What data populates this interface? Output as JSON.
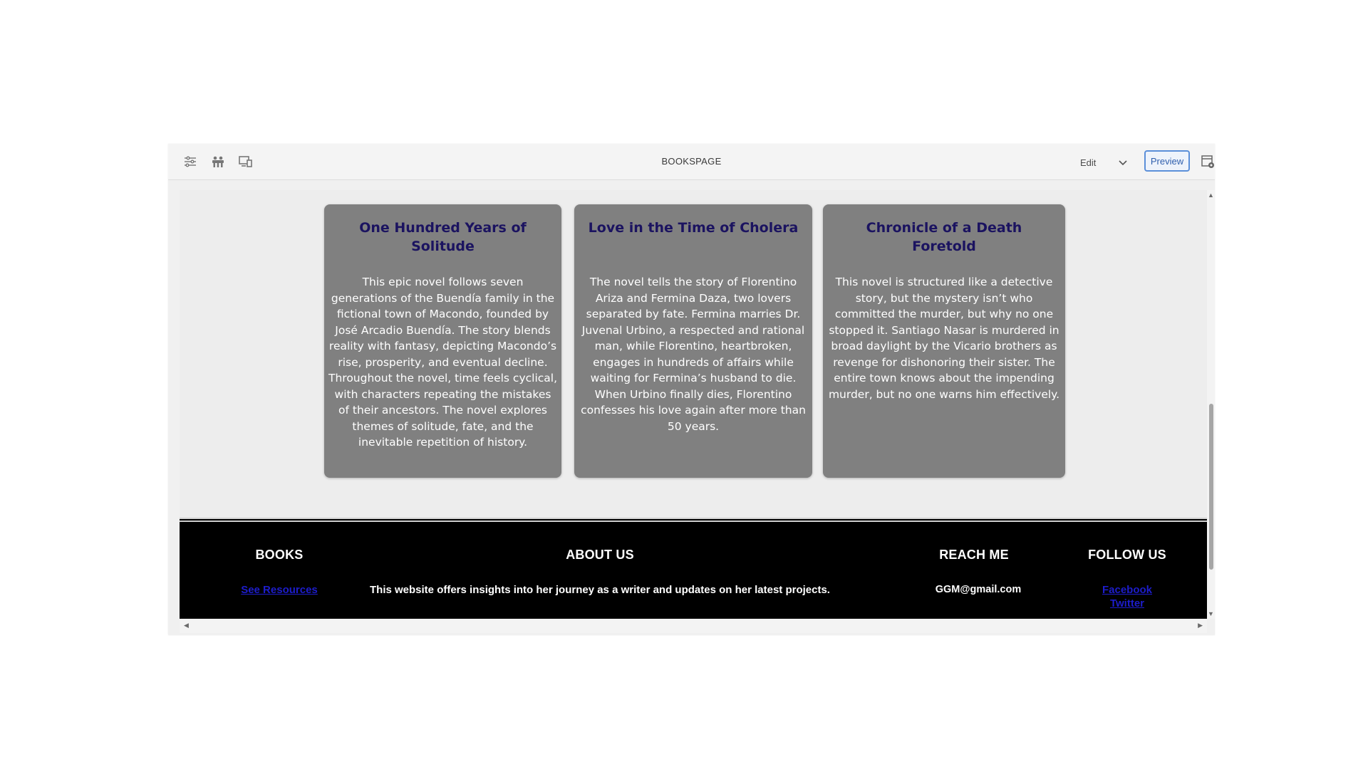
{
  "toolbar": {
    "title": "BOOKSPAGE",
    "mode_select": "Edit",
    "preview_label": "Preview",
    "left_icons": [
      "sliders-icon",
      "people-icon",
      "devices-icon"
    ],
    "right_icon": "page-settings-icon"
  },
  "books": [
    {
      "title": "One Hundred Years of Solitude",
      "description": "This epic novel follows seven generations of the Buendía family in the fictional town of Macondo, founded by José Arcadio Buendía. The story blends reality with fantasy, depicting Macondo’s rise, prosperity, and eventual decline. Throughout the novel, time feels cyclical, with characters repeating the mistakes of their ancestors. The novel explores themes of solitude, fate, and the inevitable repetition of history."
    },
    {
      "title": "Love in the Time of Cholera",
      "description": "The novel tells the story of Florentino Ariza and Fermina Daza, two lovers separated by fate. Fermina marries Dr. Juvenal Urbino, a respected and rational man, while Florentino, heartbroken, engages in hundreds of affairs while waiting for Fermina’s husband to die. When Urbino finally dies, Florentino confesses his love again after more than 50 years."
    },
    {
      "title": "Chronicle of a Death Foretold",
      "description": "This novel is structured like a detective story, but the mystery isn’t who committed the murder, but why no one stopped it. Santiago Nasar is murdered in broad daylight by the Vicario brothers as revenge for dishonoring their sister. The entire town knows about the impending murder, but no one warns him effectively."
    }
  ],
  "footer": {
    "books": {
      "heading": "BOOKS",
      "link": "See Resources"
    },
    "about": {
      "heading": "ABOUT US",
      "text": "This website offers insights into her journey as a writer and updates on her latest projects."
    },
    "reach": {
      "heading": "REACH ME",
      "email": "GGM@gmail.com"
    },
    "follow": {
      "heading": "FOLLOW US",
      "links": [
        "Facebook",
        "Twitter"
      ]
    }
  },
  "colors": {
    "card_bg": "#808080",
    "card_title": "#1b1360",
    "footer_bg": "#000000",
    "link": "#1d1dcc",
    "preview_border": "#5b8fd9"
  }
}
